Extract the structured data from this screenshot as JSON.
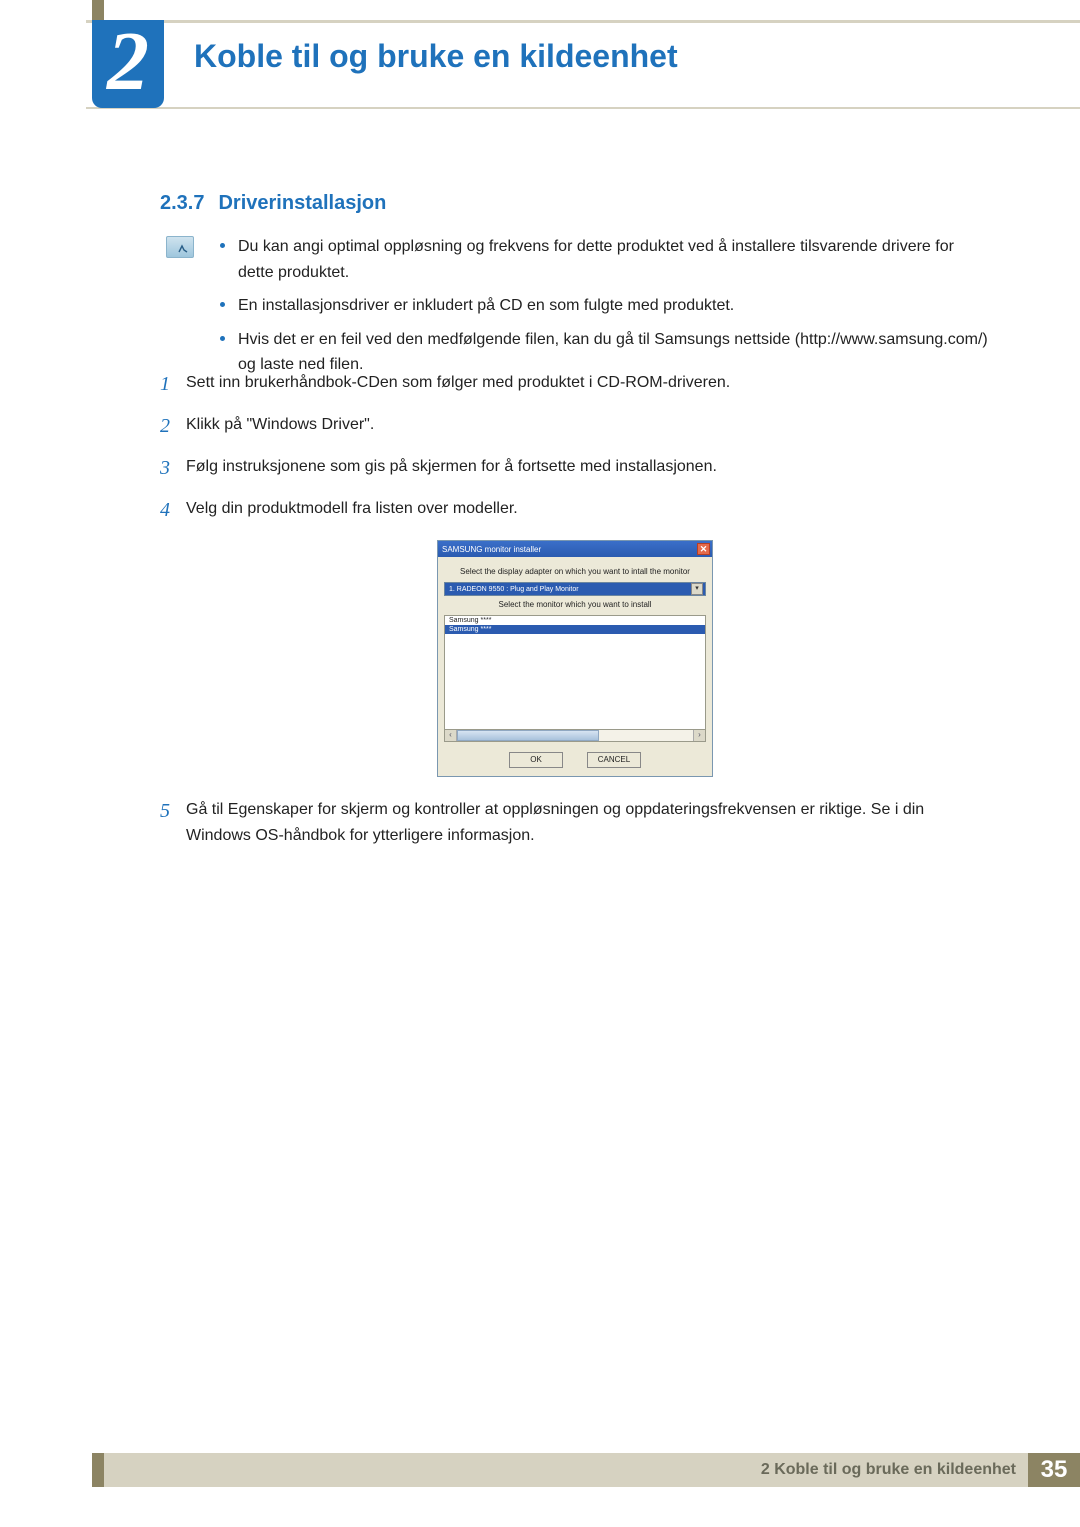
{
  "chapter": {
    "number": "2",
    "title": "Koble til og bruke en kildeenhet"
  },
  "section": {
    "number": "2.3.7",
    "title": "Driverinstallasjon"
  },
  "notes": [
    "Du kan angi optimal oppløsning og frekvens for dette produktet ved å installere tilsvarende drivere for dette produktet.",
    "En installasjonsdriver er inkludert på CD en som fulgte med produktet.",
    "Hvis det er en feil ved den medfølgende filen, kan du gå til Samsungs nettside (http://www.samsung.com/) og laste ned filen."
  ],
  "steps": [
    {
      "n": "1",
      "t": "Sett inn brukerhåndbok-CDen som følger med produktet i CD-ROM-driveren."
    },
    {
      "n": "2",
      "t": "Klikk på \"Windows Driver\"."
    },
    {
      "n": "3",
      "t": "Følg instruksjonene som gis på skjermen for å fortsette med installasjonen."
    },
    {
      "n": "4",
      "t": "Velg din produktmodell fra listen over modeller."
    },
    {
      "n": "5",
      "t": "Gå til Egenskaper for skjerm og kontroller at oppløsningen og oppdateringsfrekvensen er riktige. Se i din Windows OS-håndbok for ytterligere informasjon."
    }
  ],
  "dialog": {
    "title": "SAMSUNG monitor installer",
    "label_adapter": "Select the display adapter on which you want to intall the monitor",
    "combo_value": "1. RADEON 9550 : Plug and Play Monitor",
    "label_monitor": "Select the monitor which you want to install",
    "list_item_1": "Samsung ****",
    "list_item_2": "Samsung ****",
    "btn_ok": "OK",
    "btn_cancel": "CANCEL"
  },
  "footer": {
    "text": "2 Koble til og bruke en kildeenhet",
    "page": "35"
  }
}
